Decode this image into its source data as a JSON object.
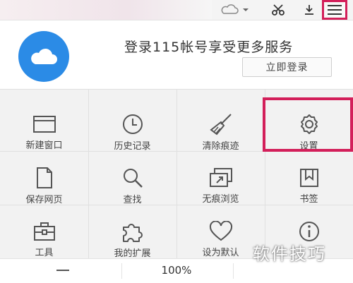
{
  "toolbar": {
    "cloud_icon": "cloud-icon",
    "scissors_icon": "scissors-icon",
    "download_icon": "download-icon",
    "menu_icon": "hamburger-menu-icon",
    "highlight_color": "#d31f5a"
  },
  "login": {
    "prompt": "登录115帐号享受更多服务",
    "button_label": "立即登录",
    "avatar_color": "#2b8be6"
  },
  "menu_items": [
    {
      "label": "新建窗口",
      "icon": "new-window-icon"
    },
    {
      "label": "历史记录",
      "icon": "clock-icon"
    },
    {
      "label": "清除痕迹",
      "icon": "broom-icon"
    },
    {
      "label": "设置",
      "icon": "gear-icon"
    },
    {
      "label": "保存网页",
      "icon": "page-icon"
    },
    {
      "label": "查找",
      "icon": "magnifier-icon"
    },
    {
      "label": "无痕浏览",
      "icon": "incognito-window-icon"
    },
    {
      "label": "书签",
      "icon": "bookmark-icon"
    },
    {
      "label": "工具",
      "icon": "toolbox-icon"
    },
    {
      "label": "我的扩展",
      "icon": "puzzle-icon"
    },
    {
      "label": "设为默认",
      "icon": "heart-icon"
    },
    {
      "label": "",
      "icon": "info-icon"
    }
  ],
  "zoom": {
    "value": "100%",
    "minus_icon": "minus-icon"
  },
  "watermark": "软件技巧"
}
